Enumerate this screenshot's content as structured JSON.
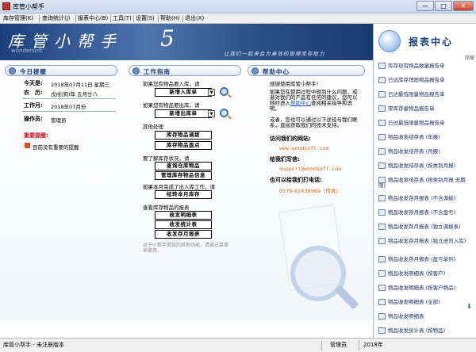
{
  "window": {
    "title": "库管小帮手",
    "controls": [
      "—",
      "□",
      "✕"
    ]
  },
  "menu": [
    "库存管理(K)",
    "查询统计(J)",
    "报表中心(B)",
    "工具(T)",
    "设置(S)",
    "帮助(H)",
    "退出(X)"
  ],
  "banner": {
    "title": "库管小帮手",
    "version": "5",
    "slogan": "让我们一起来会为高效的管理库存助力",
    "watermark": "wondersoft"
  },
  "today": {
    "header": "今日提醒",
    "date_label": "今天是:",
    "date_value": "2018年07月11日   星期三",
    "lunar_label": "农　历:",
    "lunar_value": "戊戌(狗)年  五月廿八",
    "workmonth_label": "工作月:",
    "workmonth_value": "2018年07月份",
    "operator_label": "操作员:",
    "operator_value": "管理员",
    "important_label": "重要提醒:",
    "important_item": "目前没有重要的提醒"
  },
  "guide": {
    "header": "工作指南",
    "instock_prompt": "如果您有物品要入库，请",
    "instock_button": "新增入库单",
    "outstock_prompt": "如果您有物品要出库，请",
    "outstock_button": "新增出库单",
    "other_label": "其他处理",
    "transfer_button": "库存物品调拨",
    "inventory_button": "库存物品盘点",
    "query_prompt": "要了解库存状况，请",
    "query_button": "查询仓库物品",
    "manage_button": "管理库存物品信息",
    "monthend_prompt": "如果本月完成了出入库工作，请",
    "monthend_button": "结转本月库存",
    "report_prompt": "查看库存物品的报表",
    "detail_button": "收发明细表",
    "stat_button": "收发统计表",
    "stock_button": "收发存月报表",
    "footer_note": "对于小帮手提供的其他功能，请通过菜单来使用。"
  },
  "help": {
    "header": "帮助中心",
    "welcome": "感谢使用库管小帮手！",
    "para1_a": "如果您在使用过程中碰到什么问题，或者对我们的产品有任何的建议，您可以随时进入",
    "para1_link": "帮助中心",
    "para1_b": "查阅相关指导和说明。",
    "para2": "或者，您也可以通过以下途径与我们联系，直接获取我们的技术支持。",
    "website_label": "访问我们的网站:",
    "website_value": "www.wondsoft.com",
    "email_label": "给我们写信:",
    "email_value": "Support@wondsoft.com",
    "phone_label": "也可以给我们打电话:",
    "phone_value": "0576-82439969（传真）"
  },
  "reports": {
    "title": "报表中心",
    "hide": "隐藏",
    "items": [
      "库存现有物品数量报告单",
      "已达库存顶限物品报告单",
      "已达最低限量物品报告单",
      "零库存量物品报告单",
      "已过最低限量物品报告单",
      "物品收发结存表 (年报)",
      "物品收发结存表 (月报)",
      "物品收发结存表 (按类别月报)",
      "物品收发结存表 (按类别月报 无期限)",
      "物品收发存月报表 (不含调拨)",
      "物品收发存月报表 (不含盘亏)",
      "物品收发存月报表 (独立调拨表)",
      "物品收发存月报表 (独立进货入库)",
      "物品收发存月报表 (盈亏单列)",
      "物品收发明细表 (按客户)",
      "物品收发明细表 (按客户物品)",
      "物品收发明细表 (全部)",
      "物品收发明细表",
      "物品收发统计表 (按物品)"
    ]
  },
  "status": {
    "app": "库管小帮手 - 未注册版本",
    "operator": "管理员",
    "date": "2018年"
  }
}
